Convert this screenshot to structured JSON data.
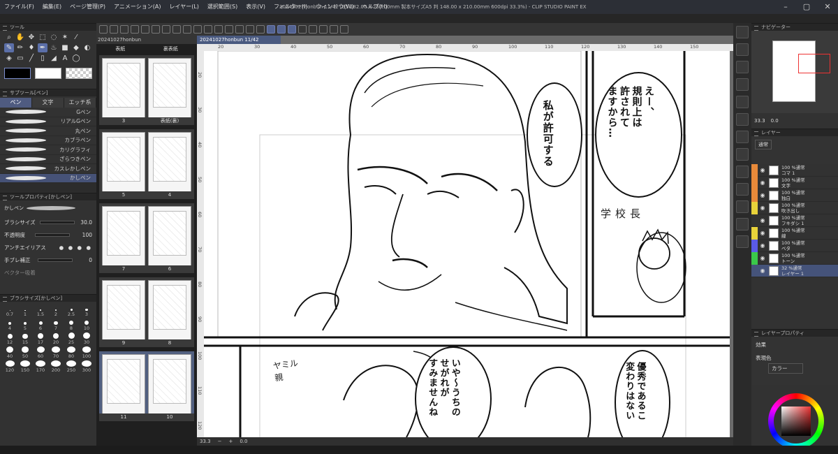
{
  "app": {
    "window_title": "20241027honbun 11/42 (B5 182.00 x 257.00mm 製本サイズA5 判 148.00 x 210.00mm 600dpi 33.3%) - CLIP STUDIO PAINT EX",
    "menu": [
      "ファイル(F)",
      "編集(E)",
      "ページ管理(P)",
      "アニメーション(A)",
      "レイヤー(L)",
      "選択範囲(S)",
      "表示(V)",
      "フィルター(I)",
      "ウィンドウ(W)",
      "ヘルプ(H)"
    ]
  },
  "tool_panel": {
    "title": "ツール"
  },
  "subtool": {
    "title": "サブツール[ペン]",
    "tabs": [
      "ペン",
      "文字",
      "エッチ系"
    ],
    "brushes": [
      "Gペン",
      "リアルGペン",
      "丸ペン",
      "カブラペン",
      "カリグラフィ",
      "ざらつきペン",
      "カスレかしペン",
      "かしペン"
    ]
  },
  "tool_property": {
    "title": "ツールプロパティ[かしペン]",
    "name": "かしペン",
    "brush_size_label": "ブラシサイズ",
    "brush_size": "30.0",
    "opacity_label": "不透明度",
    "opacity": "100",
    "aa_label": "アンチエイリアス",
    "stab_label": "手ブレ補正",
    "stab": "0",
    "vector_label": "ベクター吸着"
  },
  "brush_size_panel": {
    "title": "ブラシサイズ[かしペン]",
    "sizes": [
      "0.7",
      "1",
      "1.5",
      "2",
      "2.5",
      "3",
      "4",
      "5",
      "6",
      "7",
      "8",
      "10",
      "12",
      "15",
      "17",
      "20",
      "25",
      "30",
      "40",
      "50",
      "60",
      "70",
      "80",
      "100",
      "120",
      "150",
      "170",
      "200",
      "250",
      "300"
    ]
  },
  "pages": {
    "tab": "20241027honbun",
    "header_left": "表紙",
    "header_right": "裏表紙",
    "pairs": [
      [
        "3",
        "表紙(裏)"
      ],
      [
        "5",
        "4"
      ],
      [
        "7",
        "6"
      ],
      [
        "9",
        "8"
      ],
      [
        "11",
        "10"
      ]
    ]
  },
  "document": {
    "tab": "20241027honbun 11/42",
    "zoom": "33.3",
    "angle": "0.0",
    "ruler_h": [
      "20",
      "30",
      "40",
      "50",
      "60",
      "70",
      "80",
      "90",
      "100",
      "110",
      "120",
      "130",
      "140",
      "150"
    ],
    "ruler_v": [
      "20",
      "30",
      "40",
      "50",
      "60",
      "70",
      "80",
      "90",
      "100",
      "110",
      "120"
    ]
  },
  "manga": {
    "bubble1": "私が許可する",
    "bubble2": "えー、\n規則上は\n許されて\nますから…",
    "principal_label": "学校長",
    "bubble3": "いや〜うちの\nせがれが\nすみませんね",
    "bubble4": "優秀であるこ\n変わりはない",
    "handwritten": "ヤミル\n親"
  },
  "navigator": {
    "title": "ナビゲーター",
    "zoom": "33.3",
    "angle": "0.0"
  },
  "layers": {
    "title": "レイヤー",
    "blend": "通常",
    "items": [
      {
        "pct": "100 %通常",
        "name": "コマ 1",
        "color": "#e88a3a"
      },
      {
        "pct": "100 %通常",
        "name": "文字",
        "color": "#e88a3a"
      },
      {
        "pct": "100 %通常",
        "name": "独白",
        "color": "#e88a3a"
      },
      {
        "pct": "100 %通常",
        "name": "吹き出し",
        "color": "#e8d23a"
      },
      {
        "pct": "100 %通常",
        "name": "フキダシ 1",
        "color": ""
      },
      {
        "pct": "100 %通常",
        "name": "線",
        "color": "#e8d23a"
      },
      {
        "pct": "100 %通常",
        "name": "ベタ",
        "color": "#5a5ae8"
      },
      {
        "pct": "100 %通常",
        "name": "トーン",
        "color": "#3ac84a"
      },
      {
        "pct": "32 %通常",
        "name": "レイヤー 1",
        "color": ""
      }
    ]
  },
  "layer_property": {
    "title": "レイヤープロパティ",
    "effect_label": "効果",
    "color_label": "表現色",
    "color_value": "カラー"
  },
  "colors": {
    "accent": "#5b6fa8",
    "selected_bg": "#45537a",
    "main_color": "#000000"
  }
}
